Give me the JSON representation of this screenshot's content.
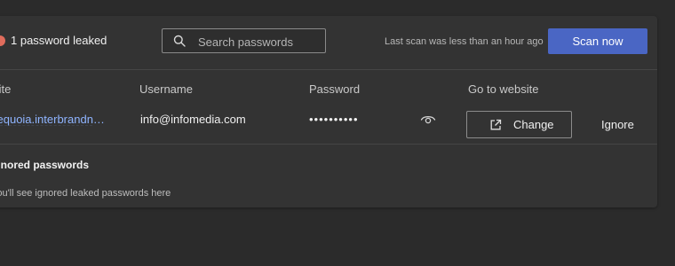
{
  "header": {
    "leak_count_text": "1 password leaked",
    "search": {
      "placeholder": "Search passwords",
      "value": ""
    },
    "scan_status": "Last scan was less than an hour ago",
    "scan_button": "Scan now"
  },
  "table": {
    "columns": [
      "Site",
      "Username",
      "Password",
      "Go to website"
    ],
    "rows": [
      {
        "site": "sequoia.interbrandnet.com",
        "username": "info@infomedia.com",
        "password_masked": "••••••••••",
        "change_label": "Change",
        "ignore_label": "Ignore"
      }
    ]
  },
  "ignored": {
    "title": "Ignored passwords",
    "empty_text": "You'll see ignored leaked passwords here"
  },
  "colors": {
    "accent": "#4a66c4",
    "link": "#8fb4ff",
    "warning": "#e06c5c",
    "panel": "#333333",
    "background": "#2b2b2b"
  },
  "icons": [
    "warning-icon",
    "search-icon",
    "eye-icon",
    "external-link-icon"
  ]
}
